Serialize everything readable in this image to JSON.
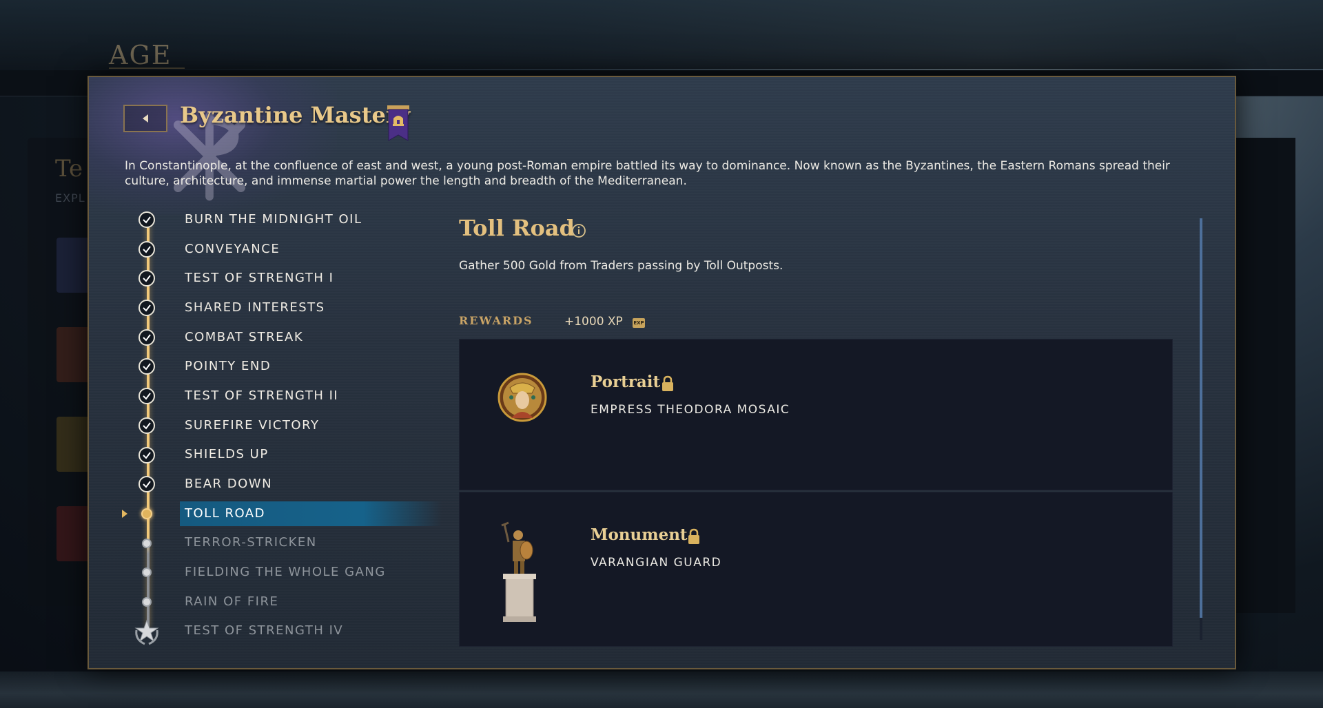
{
  "background": {
    "logo": "AGE",
    "left_title": "Te",
    "left_subtitle": "EXPL"
  },
  "dialog": {
    "title": "Byzantine Mastery",
    "civ_icon": "byzantine-banner-icon",
    "description": "In Constantinople, at the confluence of east and west, a young post-Roman empire battled its way to dominance. Now known as the Byzantines, the Eastern Romans spread their culture, architecture, and immense martial power the length and breadth of the Mediterranean."
  },
  "challenges": [
    {
      "label": "BURN THE MIDNIGHT OIL",
      "status": "completed"
    },
    {
      "label": "CONVEYANCE",
      "status": "completed"
    },
    {
      "label": "TEST OF STRENGTH I",
      "status": "completed"
    },
    {
      "label": "SHARED INTERESTS",
      "status": "completed"
    },
    {
      "label": "COMBAT STREAK",
      "status": "completed"
    },
    {
      "label": "POINTY END",
      "status": "completed"
    },
    {
      "label": "TEST OF STRENGTH II",
      "status": "completed"
    },
    {
      "label": "SUREFIRE VICTORY",
      "status": "completed"
    },
    {
      "label": "SHIELDS UP",
      "status": "completed"
    },
    {
      "label": "BEAR DOWN",
      "status": "completed"
    },
    {
      "label": "TOLL ROAD",
      "status": "current"
    },
    {
      "label": "TERROR-STRICKEN",
      "status": "locked"
    },
    {
      "label": "FIELDING THE WHOLE GANG",
      "status": "locked"
    },
    {
      "label": "RAIN OF FIRE",
      "status": "locked"
    },
    {
      "label": "TEST OF STRENGTH IV",
      "status": "final"
    }
  ],
  "detail": {
    "title": "Toll Road",
    "description": "Gather 500 Gold from Traders passing by Toll Outposts.",
    "rewards_label": "REWARDS",
    "xp": "+1000 XP",
    "xp_icon_text": "EXP"
  },
  "rewards": [
    {
      "type": "Portrait",
      "name": "EMPRESS THEODORA MOSAIC",
      "icon": "portrait-image",
      "locked": true
    },
    {
      "type": "Monument",
      "name": "VARANGIAN GUARD",
      "icon": "monument-statue-image",
      "locked": true
    }
  ],
  "colors": {
    "accent_gold": "#e3c07f",
    "highlight_blue": "#16628a",
    "dialog_bg": "#2b3644"
  }
}
